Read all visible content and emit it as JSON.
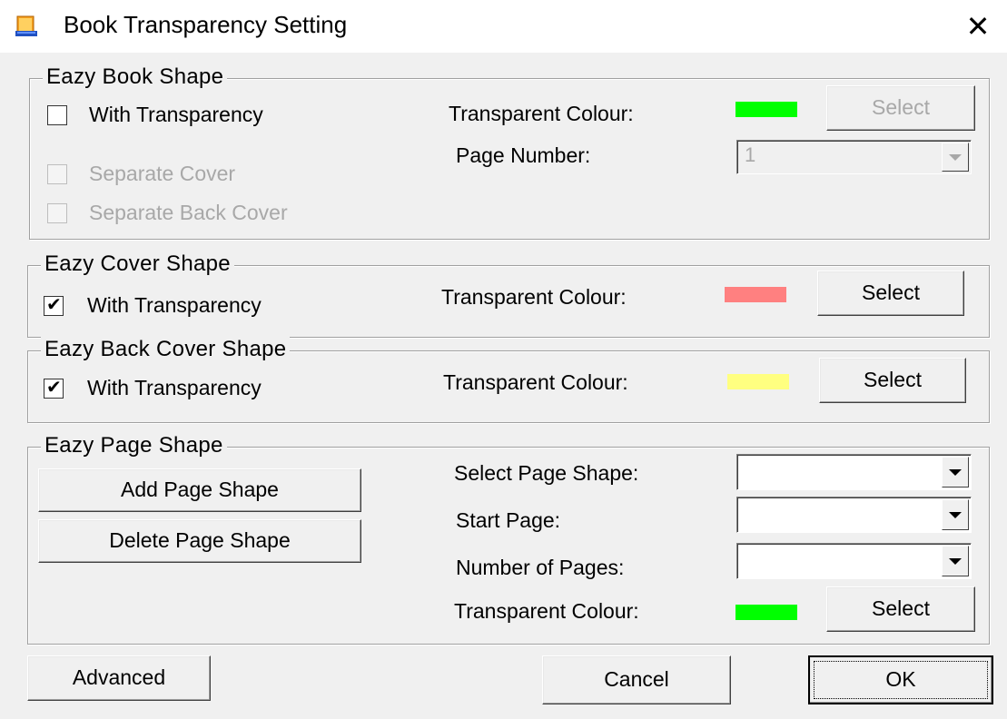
{
  "window": {
    "title": "Book Transparency Setting",
    "close_glyph": "✕",
    "icon": "app-book-icon"
  },
  "book_shape": {
    "legend": "Eazy Book Shape",
    "with_transparency": {
      "label": "With Transparency",
      "checked": false
    },
    "separate_cover": {
      "label": "Separate Cover",
      "checked": false,
      "disabled": true
    },
    "separate_back_cover": {
      "label": "Separate Back Cover",
      "checked": false,
      "disabled": true
    },
    "transparent_colour_label": "Transparent Colour:",
    "colour": "#00ff00",
    "select_label": "Select",
    "page_number_label": "Page Number:",
    "page_number_value": "1"
  },
  "cover_shape": {
    "legend": "Eazy Cover Shape",
    "with_transparency": {
      "label": "With Transparency",
      "checked": true
    },
    "transparent_colour_label": "Transparent Colour:",
    "colour": "#ff8080",
    "select_label": "Select"
  },
  "back_cover_shape": {
    "legend": "Eazy Back Cover Shape",
    "with_transparency": {
      "label": "With Transparency",
      "checked": true
    },
    "transparent_colour_label": "Transparent Colour:",
    "colour": "#ffff80",
    "select_label": "Select"
  },
  "page_shape": {
    "legend": "Eazy Page Shape",
    "add_label": "Add Page Shape",
    "delete_label": "Delete Page Shape",
    "select_page_shape_label": "Select Page Shape:",
    "select_page_shape_value": "",
    "start_page_label": "Start Page:",
    "start_page_value": "",
    "number_of_pages_label": "Number of Pages:",
    "number_of_pages_value": "",
    "transparent_colour_label": "Transparent Colour:",
    "colour": "#00ff00",
    "select_label": "Select"
  },
  "footer": {
    "advanced_label": "Advanced",
    "cancel_label": "Cancel",
    "ok_label": "OK"
  }
}
